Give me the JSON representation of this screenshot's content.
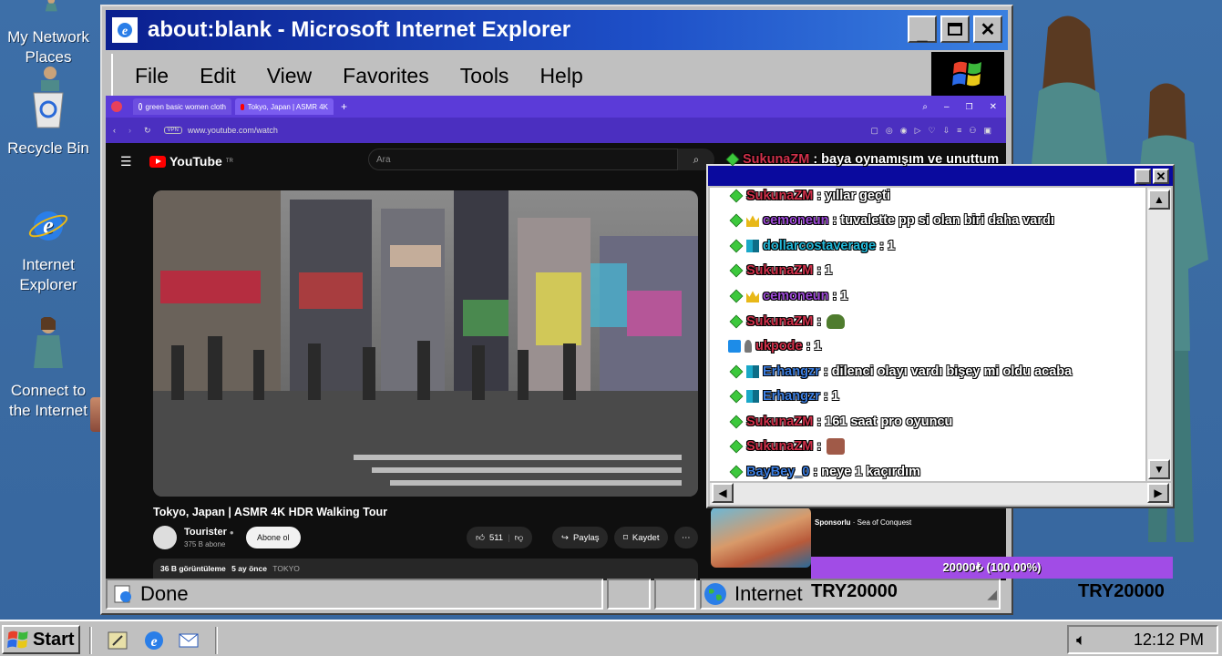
{
  "desktop": {
    "icons": [
      {
        "label": "My Network Places"
      },
      {
        "label": "Recycle Bin"
      },
      {
        "label": "Internet Explorer"
      },
      {
        "label": "Connect to the Internet"
      }
    ]
  },
  "ie": {
    "title": "about:blank - Microsoft Internet Explorer",
    "menu": [
      "File",
      "Edit",
      "View",
      "Favorites",
      "Tools",
      "Help"
    ],
    "status": "Done",
    "zone": "Internet"
  },
  "browser": {
    "tabs": [
      "green basic women cloth",
      "Tokyo, Japan | ASMR 4K"
    ],
    "url": "www.youtube.com/watch"
  },
  "youtube": {
    "logo": "YouTube",
    "logo_sup": "TR",
    "search_placeholder": "Ara",
    "video_title": "Tokyo, Japan | ASMR 4K HDR Walking Tour",
    "channel_name": "Tourister",
    "channel_subs": "375 B abone",
    "subscribe": "Abone ol",
    "likes": "511",
    "share": "Paylaş",
    "save": "Kaydet",
    "views": "36 B görüntüleme",
    "ago": "5 ay önce",
    "tag": "TOKYO",
    "sponsor_label": "Sponsorlu",
    "sponsor_name": "Sea of Conquest"
  },
  "chat": {
    "top_message": {
      "user": "SukunaZM",
      "text": ": baya oynamışım ve unuttum"
    },
    "messages": [
      {
        "user": "SukunaZM",
        "text": ": yıllar geçti"
      },
      {
        "user": "cemoneun",
        "text": ": tuvalette pp si olan biri daha vardı"
      },
      {
        "user": "dollarcostaverage",
        "text": ": 1"
      },
      {
        "user": "SukunaZM",
        "text": ": 1"
      },
      {
        "user": "cemoneun",
        "text": ": 1"
      },
      {
        "user": "SukunaZM",
        "text": ":"
      },
      {
        "user": "ukpode",
        "text": ": 1"
      },
      {
        "user": "Erhangzr",
        "text": ": dilenci olayı vardı bişey mi oldu acaba"
      },
      {
        "user": "Erhangzr",
        "text": ": 1"
      },
      {
        "user": "SukunaZM",
        "text": ": 161 saat pro oyuncu"
      },
      {
        "user": "SukunaZM",
        "text": ":"
      },
      {
        "user": "BayBey_0",
        "text": ": neye 1 kaçırdım"
      }
    ]
  },
  "donation": {
    "bar_text": "20000₺ (100.00%)",
    "progress": 1.0,
    "amount_left": "TRY20000",
    "amount_right": "TRY20000"
  },
  "taskbar": {
    "start": "Start",
    "clock": "12:12 PM"
  }
}
